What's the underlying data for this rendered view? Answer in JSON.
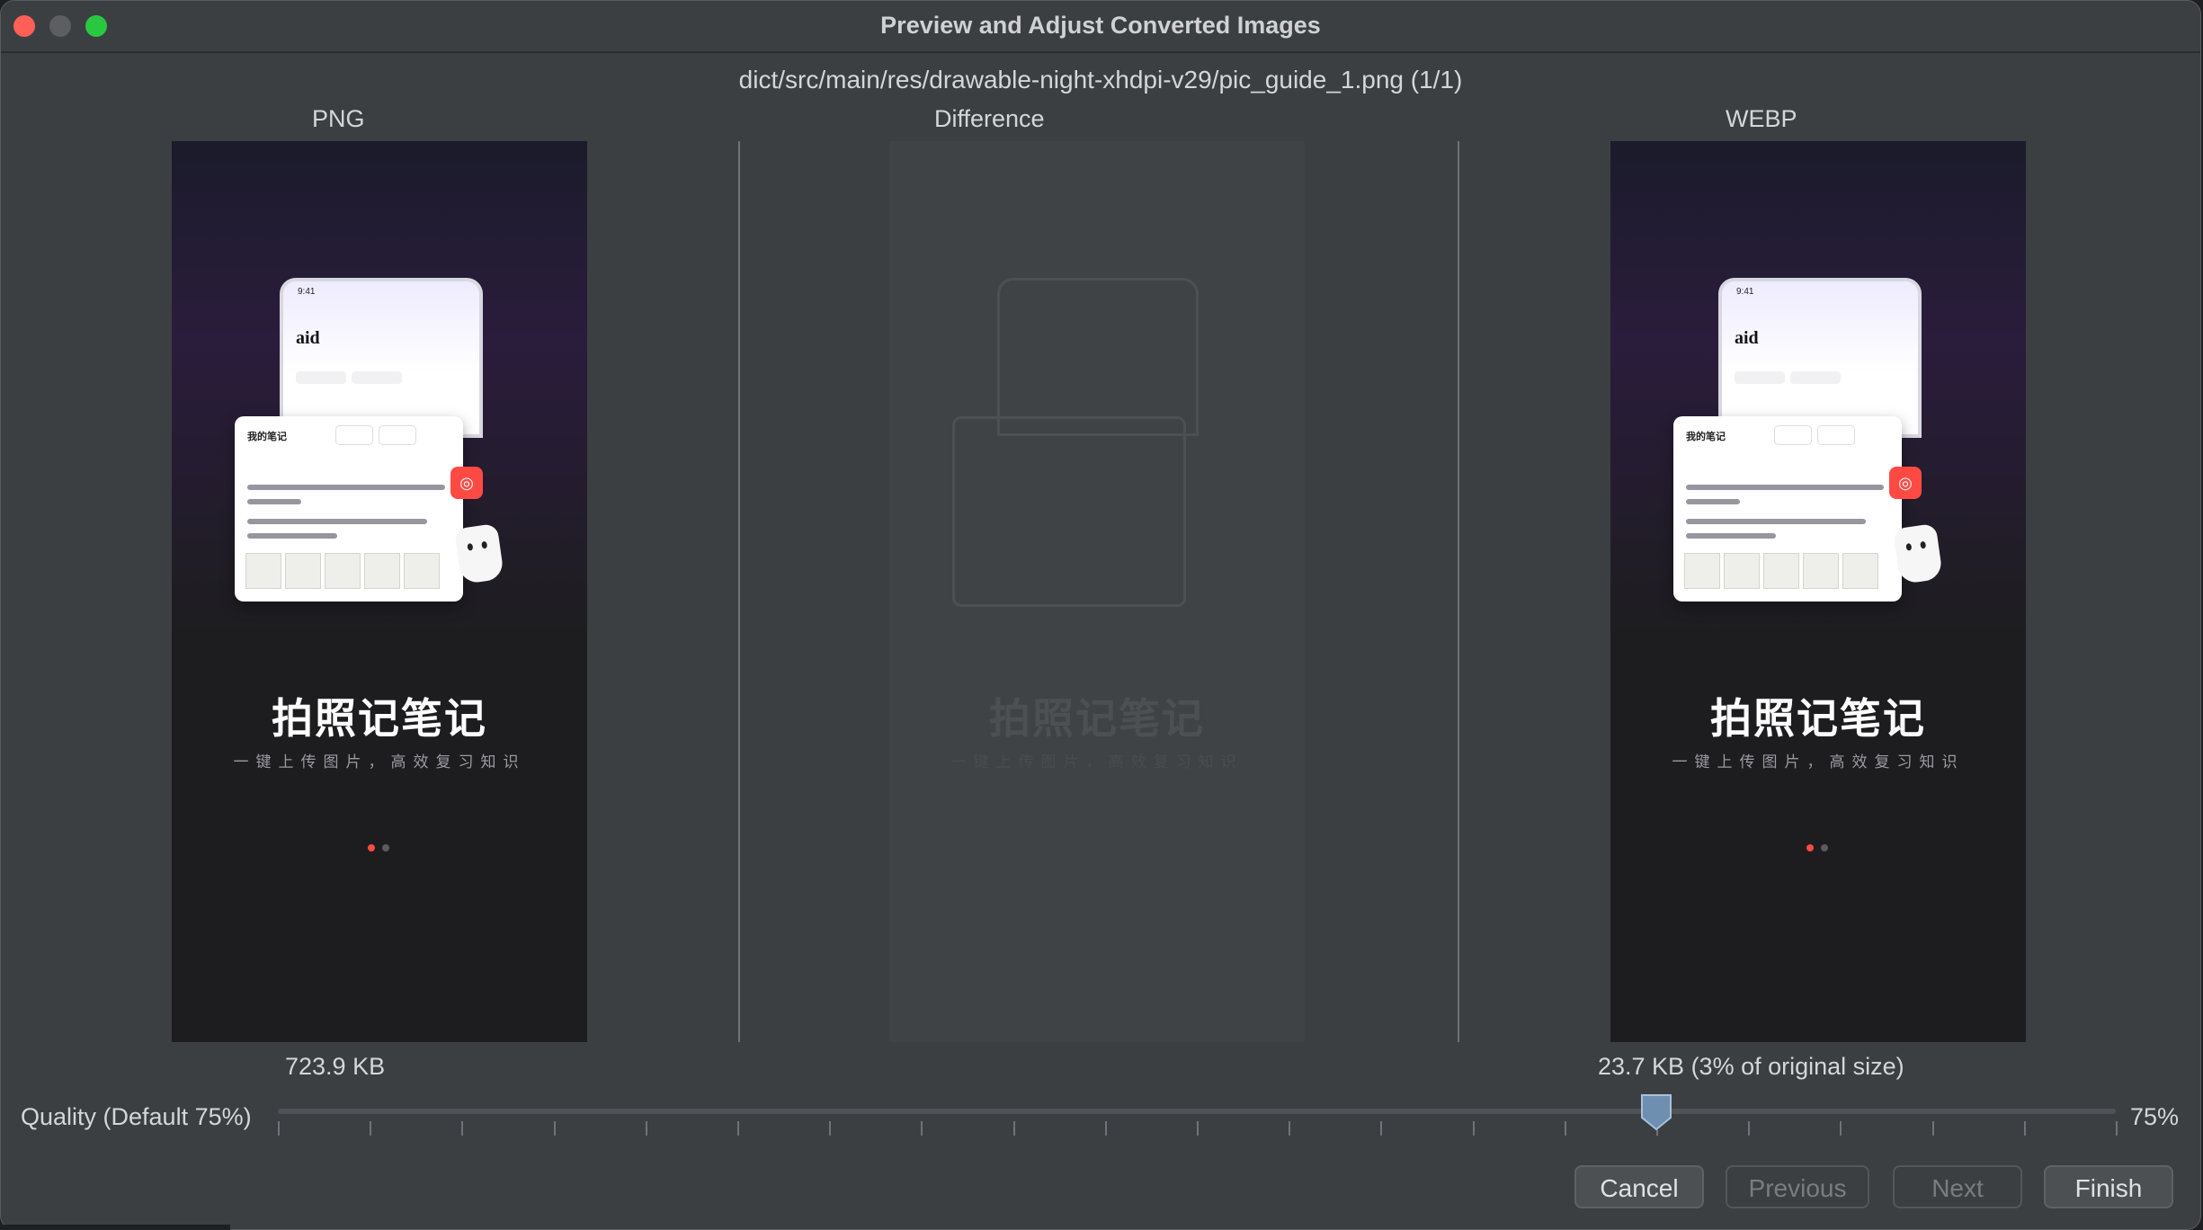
{
  "window": {
    "title": "Preview and Adjust Converted Images"
  },
  "file": {
    "path": "dict/src/main/res/drawable-night-xhdpi-v29/pic_guide_1.png (1/1)"
  },
  "columns": {
    "png_label": "PNG",
    "difference_label": "Difference",
    "webp_label": "WEBP"
  },
  "preview_content": {
    "status_time": "9:41",
    "word": "aid",
    "note_header": "我的笔记",
    "headline": "拍照记笔记",
    "subline": "一键上传图片，高效复习知识"
  },
  "sizes": {
    "png": "723.9 KB",
    "webp": "23.7 KB (3% of original size)"
  },
  "quality": {
    "label": "Quality (Default 75%)",
    "value_text": "75%",
    "value": 75,
    "min": 0,
    "max": 100
  },
  "buttons": {
    "cancel": "Cancel",
    "previous": "Previous",
    "next": "Next",
    "finish": "Finish"
  },
  "colors": {
    "accent_dot": "#ff4a44",
    "slider_thumb": "#6e8fb0"
  }
}
